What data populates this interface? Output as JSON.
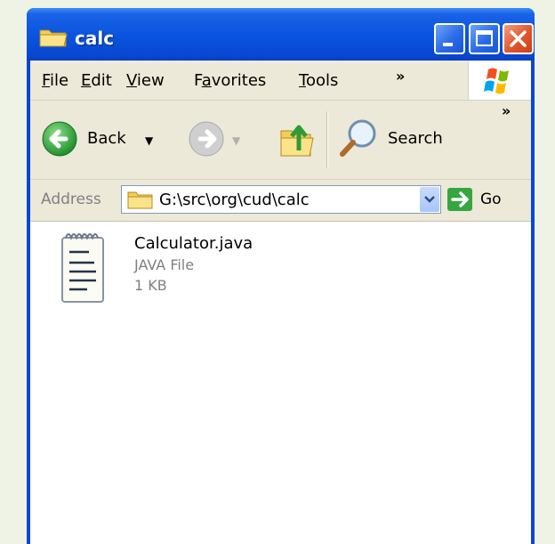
{
  "window": {
    "title": "calc"
  },
  "menu": {
    "items": [
      {
        "label": "File",
        "underline": "F"
      },
      {
        "label": "Edit",
        "underline": "E"
      },
      {
        "label": "View",
        "underline": "V"
      },
      {
        "label": "Favorites",
        "underline": "a"
      },
      {
        "label": "Tools",
        "underline": "T"
      }
    ],
    "overflow": "»"
  },
  "toolbar": {
    "back_label": "Back",
    "search_label": "Search",
    "overflow": "»"
  },
  "address": {
    "label": "Address",
    "value": "G:\\src\\org\\cud\\calc",
    "go_label": "Go"
  },
  "files": [
    {
      "name": "Calculator.java",
      "type": "JAVA File",
      "size": "1 KB"
    }
  ],
  "colors": {
    "title_bar": "#0a55e0",
    "chrome": "#ece9d8",
    "close_button": "#e2552b",
    "back_green": "#2fa83a"
  }
}
